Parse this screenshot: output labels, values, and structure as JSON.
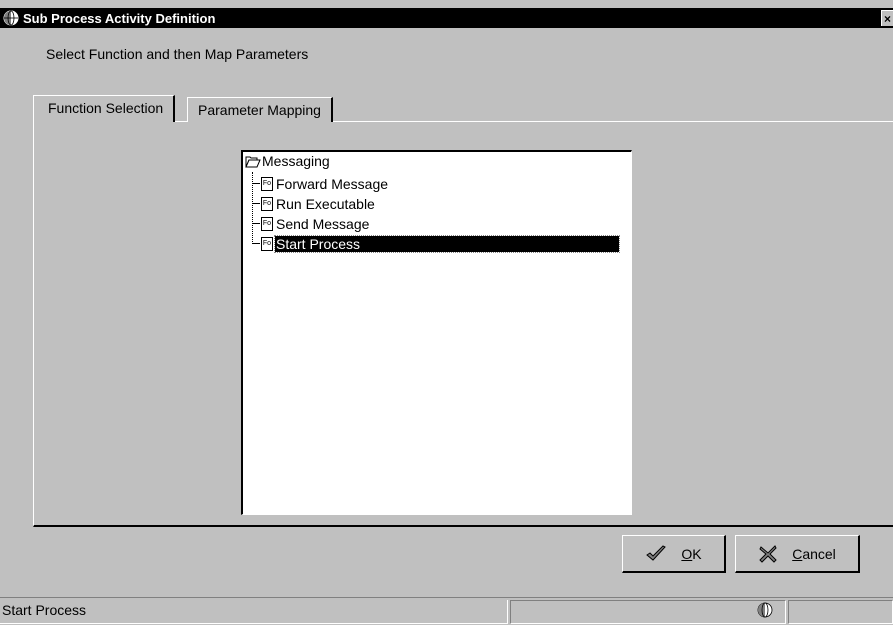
{
  "window": {
    "title": "Sub Process Activity Definition",
    "close_glyph": "×"
  },
  "instruction": "Select Function and then Map Parameters",
  "tabs": [
    {
      "label": "Function Selection",
      "active": true
    },
    {
      "label": "Parameter Mapping",
      "active": false
    }
  ],
  "tree": {
    "root": {
      "label": "Messaging",
      "icon": "open-folder-icon"
    },
    "items": [
      {
        "label": "Forward Message",
        "icon": "function-object-icon",
        "selected": false
      },
      {
        "label": "Run Executable",
        "icon": "function-object-icon",
        "selected": false
      },
      {
        "label": "Send Message",
        "icon": "function-object-icon",
        "selected": false
      },
      {
        "label": "Start Process",
        "icon": "function-object-icon",
        "selected": true
      }
    ],
    "item_icon_text": "Fo"
  },
  "buttons": {
    "ok": {
      "label_u": "O",
      "label_rest": "K",
      "icon": "checkmark-icon"
    },
    "cancel": {
      "label_u": "C",
      "label_rest": "ancel",
      "icon": "x-icon"
    }
  },
  "status": {
    "text": "Start Process"
  },
  "colors": {
    "face": "#c0c0c0",
    "titlebar": "#000000",
    "selection": "#000000"
  }
}
